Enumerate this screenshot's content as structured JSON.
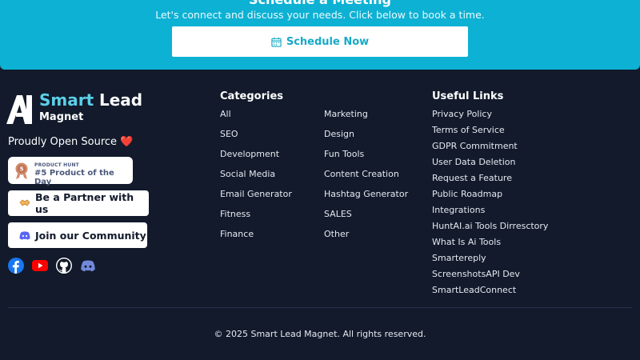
{
  "cta": {
    "title": "Schedule a Meeting",
    "subtitle": "Let's connect and discuss your needs. Click below to book a time.",
    "button_label": "Schedule Now",
    "button_icon": "calendar-icon"
  },
  "brand": {
    "smart": "Smart",
    "lead": "Lead",
    "magnet": "Magnet",
    "accent_color": "#5bd0e8"
  },
  "open_source": {
    "label": "Proudly Open Source",
    "emoji": "❤️"
  },
  "product_hunt": {
    "small": "PRODUCT HUNT",
    "big": "#5 Product of the Day"
  },
  "partner": {
    "label": "Be a Partner with us",
    "icon": "handshake-icon"
  },
  "community": {
    "label": "Join our Community",
    "icon": "discord-icon"
  },
  "socials": [
    "facebook-icon",
    "youtube-icon",
    "github-icon",
    "discord-icon"
  ],
  "categories": {
    "heading": "Categories",
    "left": [
      "All",
      "SEO",
      "Development",
      "Social Media",
      "Email Generator",
      "Fitness",
      "Finance"
    ],
    "right": [
      "Marketing",
      "Design",
      "Fun Tools",
      "Content Creation",
      "Hashtag Generator",
      "SALES",
      "Other"
    ]
  },
  "useful_links": {
    "heading": "Useful Links",
    "items": [
      "Privacy Policy",
      "Terms of Service",
      "GDPR Commitment",
      "User Data Deletion",
      "Request a Feature",
      "Public Roadmap",
      "Integrations",
      "HuntAI.ai Tools Dirresctory",
      "What Is Ai Tools",
      "Smartereply",
      "ScreenshotsAPI Dev",
      "SmartLeadConnect"
    ]
  },
  "footer": {
    "copyright": "© 2025 Smart Lead Magnet. All rights reserved."
  },
  "colors": {
    "background": "#121a2b",
    "cta_background": "#0db1d3",
    "button_text": "#17a9c8"
  }
}
